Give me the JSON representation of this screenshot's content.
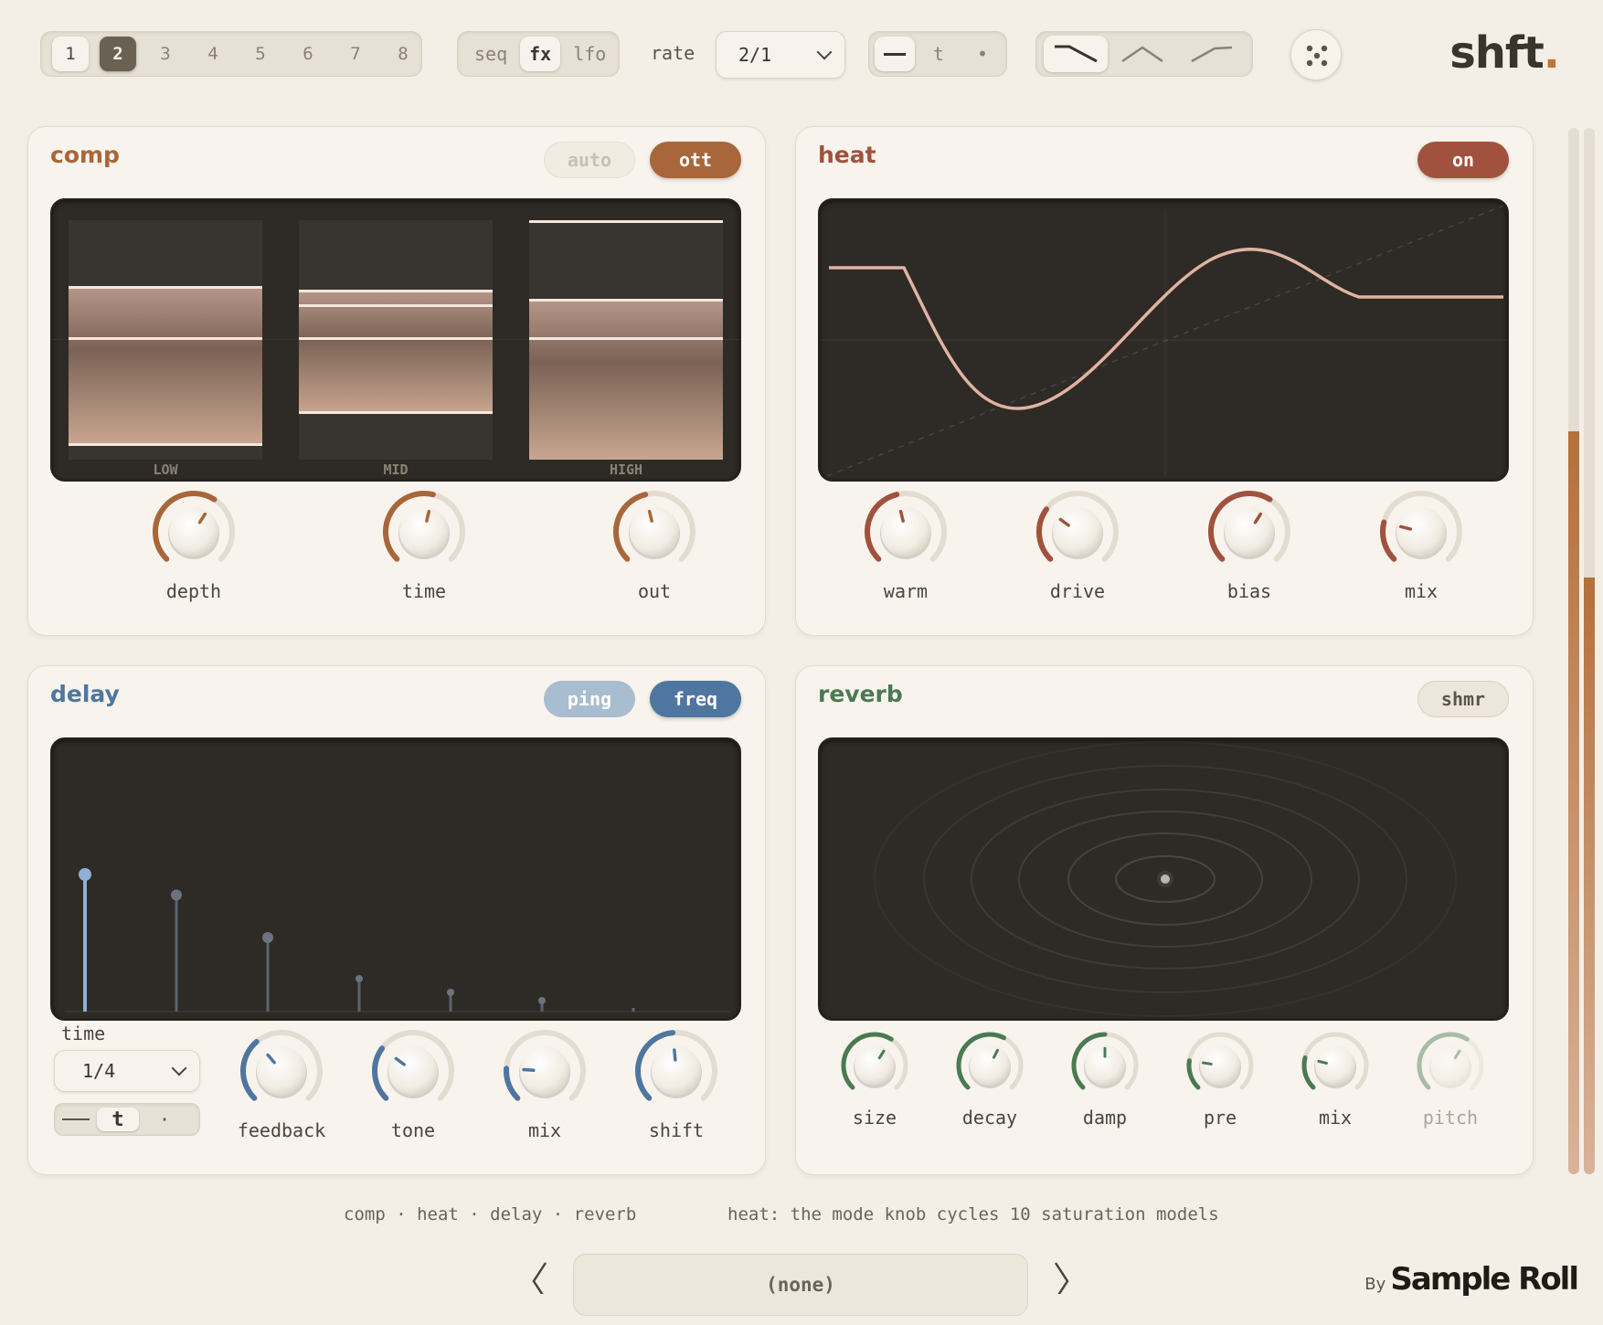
{
  "topbar": {
    "presets": [
      "1",
      "2",
      "3",
      "4",
      "5",
      "6",
      "7",
      "8"
    ],
    "selected_preset": "2",
    "modes": [
      "seq",
      "fx",
      "lfo"
    ],
    "selected_mode": "fx",
    "rate_label": "rate",
    "rate_value": "2/1",
    "sync_modes": [
      "—",
      "t",
      "•"
    ],
    "curve_shapes": [
      "ramp-down",
      "triangle",
      "ramp-up"
    ],
    "logo": "shft",
    "logo_dot": "."
  },
  "comp": {
    "title": "comp",
    "auto_label": "auto",
    "ott_label": "ott",
    "bands": [
      "LOW",
      "MID",
      "HIGH"
    ],
    "knobs": [
      {
        "label": "depth",
        "value": 0.62
      },
      {
        "label": "time",
        "value": 0.55
      },
      {
        "label": "out",
        "value": 0.45
      }
    ],
    "color": "#a8663a"
  },
  "heat": {
    "title": "heat",
    "on_label": "on",
    "knobs": [
      {
        "label": "warm",
        "value": 0.45
      },
      {
        "label": "drive",
        "value": 0.3
      },
      {
        "label": "bias",
        "value": 0.62
      },
      {
        "label": "mix",
        "value": 0.22
      }
    ],
    "color": "#a0523e"
  },
  "delay": {
    "title": "delay",
    "ping_label": "ping",
    "freq_label": "freq",
    "time_label": "time",
    "time_value": "1/4",
    "sync_modes": [
      "—",
      "t",
      "·"
    ],
    "knobs": [
      {
        "label": "feedback",
        "value": 0.35
      },
      {
        "label": "tone",
        "value": 0.3
      },
      {
        "label": "mix",
        "value": 0.18
      },
      {
        "label": "shift",
        "value": 0.48
      }
    ],
    "taps": [
      1.0,
      0.85,
      0.54,
      0.24,
      0.14,
      0.08,
      0.0
    ],
    "color": "#4e76a0"
  },
  "reverb": {
    "title": "reverb",
    "shmr_label": "shmr",
    "knobs": [
      {
        "label": "size",
        "value": 0.62
      },
      {
        "label": "decay",
        "value": 0.6
      },
      {
        "label": "damp",
        "value": 0.5
      },
      {
        "label": "pre",
        "value": 0.2
      },
      {
        "label": "mix",
        "value": 0.22
      },
      {
        "label": "pitch",
        "value": 0.62
      }
    ],
    "color": "#4a7a52"
  },
  "footer": {
    "modules": "comp · heat · delay · reverb",
    "hint": "heat: the mode knob cycles 10 saturation models",
    "preset_name": "(none)",
    "by": "By",
    "brand": "Sample Roll"
  }
}
